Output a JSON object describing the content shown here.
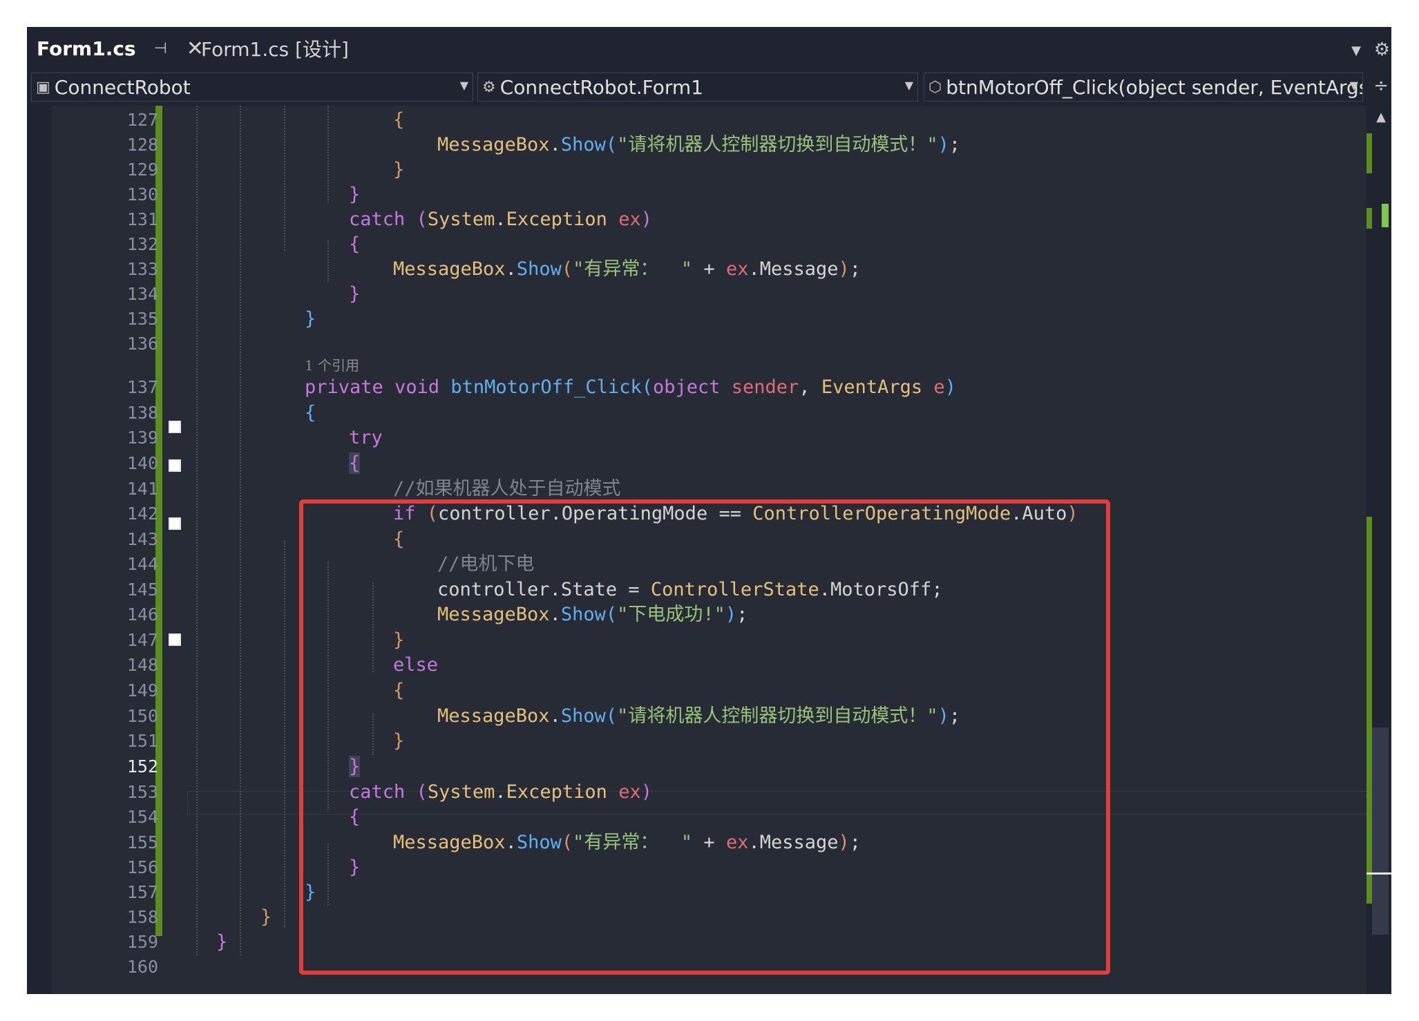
{
  "tabs": [
    {
      "label": "Form1.cs",
      "active": true
    },
    {
      "label": "Form1.cs [设计]",
      "active": false
    }
  ],
  "nav": {
    "project": "ConnectRobot",
    "class": "ConnectRobot.Form1",
    "member": "btnMotorOff_Click(object sender, EventArgs e)"
  },
  "codelens": "1 个引用",
  "current_line": "152",
  "line_numbers": [
    "127",
    "128",
    "129",
    "130",
    "131",
    "132",
    "133",
    "134",
    "135",
    "136",
    "137",
    "138",
    "139",
    "140",
    "141",
    "142",
    "143",
    "144",
    "145",
    "146",
    "147",
    "148",
    "149",
    "150",
    "151",
    "152",
    "153",
    "154",
    "155",
    "156",
    "157",
    "158",
    "159",
    "160"
  ],
  "strings": {
    "switch_auto": "\"请将机器人控制器切换到自动模式！\"",
    "exception": "\"有异常：  \"",
    "motors_off_ok": "\"下电成功!\""
  },
  "comments": {
    "if_auto": "//如果机器人处于自动模式",
    "motors_off": "//电机下电"
  },
  "tokens": {
    "catch": "catch",
    "try": "try",
    "if": "if",
    "else": "else",
    "private": "private",
    "void": "void",
    "object": "object",
    "messagebox": "MessageBox",
    "show": "Show",
    "system": "System",
    "exception": "Exception",
    "ex": "ex",
    "message": "Message",
    "method": "btnMotorOff_Click",
    "sender": "sender",
    "eventargs": "EventArgs",
    "e": "e",
    "controller": "controller",
    "operatingmode": "OperatingMode",
    "opmode_enum": "ControllerOperatingMode",
    "auto": "Auto",
    "state": "State",
    "state_enum": "ControllerState",
    "motorsoff": "MotorsOff"
  },
  "colors": {
    "editor_bg": "#272b36",
    "keyword": "#c678dd",
    "type": "#e5c07b",
    "method": "#61afef",
    "string": "#98c379",
    "variable": "#e06c75",
    "comment": "#7f848e",
    "change_bar": "#5a8f1f",
    "highlight_box": "#e23c3c"
  }
}
